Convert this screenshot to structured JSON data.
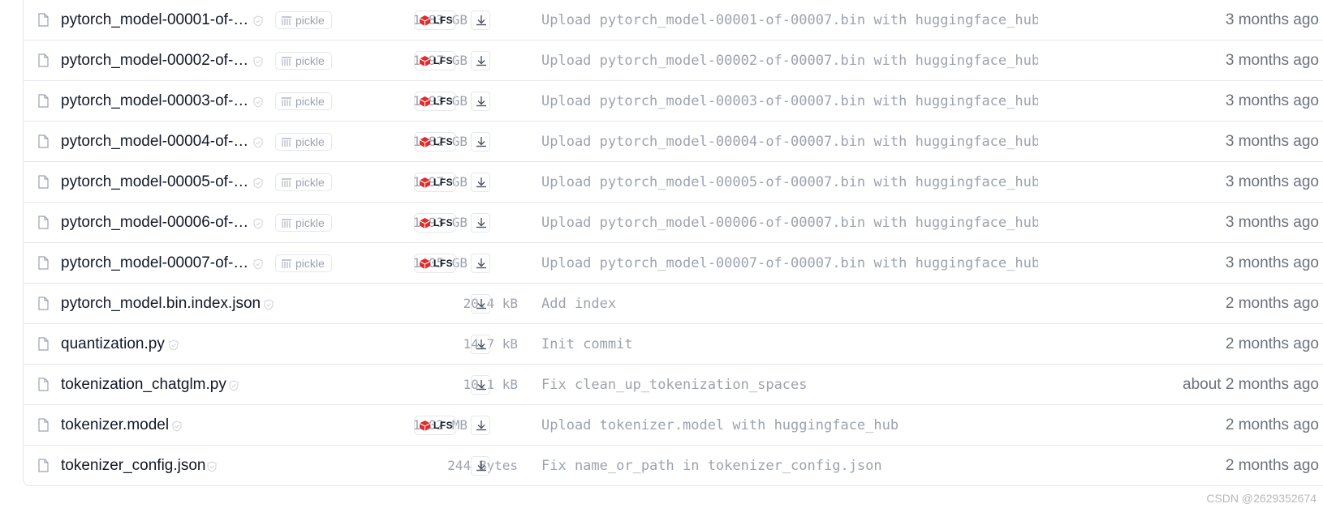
{
  "files": [
    {
      "name": "pytorch_model-00001-of-…",
      "pickle": "pickle",
      "size": "1.83 GB",
      "lfs": "LFS",
      "message": "Upload pytorch_model-00001-of-00007.bin with huggingface_hub",
      "time": "3 months ago"
    },
    {
      "name": "pytorch_model-00002-of-…",
      "pickle": "pickle",
      "size": "1.97 GB",
      "lfs": "LFS",
      "message": "Upload pytorch_model-00002-of-00007.bin with huggingface_hub",
      "time": "3 months ago"
    },
    {
      "name": "pytorch_model-00003-of-…",
      "pickle": "pickle",
      "size": "1.93 GB",
      "lfs": "LFS",
      "message": "Upload pytorch_model-00003-of-00007.bin with huggingface_hub",
      "time": "3 months ago"
    },
    {
      "name": "pytorch_model-00004-of-…",
      "pickle": "pickle",
      "size": "1.82 GB",
      "lfs": "LFS",
      "message": "Upload pytorch_model-00004-of-00007.bin with huggingface_hub",
      "time": "3 months ago"
    },
    {
      "name": "pytorch_model-00005-of-…",
      "pickle": "pickle",
      "size": "1.97 GB",
      "lfs": "LFS",
      "message": "Upload pytorch_model-00005-of-00007.bin with huggingface_hub",
      "time": "3 months ago"
    },
    {
      "name": "pytorch_model-00006-of-…",
      "pickle": "pickle",
      "size": "1.93 GB",
      "lfs": "LFS",
      "message": "Upload pytorch_model-00006-of-00007.bin with huggingface_hub",
      "time": "3 months ago"
    },
    {
      "name": "pytorch_model-00007-of-…",
      "pickle": "pickle",
      "size": "1.05 GB",
      "lfs": "LFS",
      "message": "Upload pytorch_model-00007-of-00007.bin with huggingface_hub",
      "time": "3 months ago"
    },
    {
      "name": "pytorch_model.bin.index.json",
      "size": "20.4 kB",
      "message": "Add index",
      "time": "2 months ago"
    },
    {
      "name": "quantization.py",
      "size": "14.7 kB",
      "message": "Init commit",
      "time": "2 months ago"
    },
    {
      "name": "tokenization_chatglm.py",
      "size": "10.1 kB",
      "message": "Fix clean_up_tokenization_spaces",
      "time": "about 2 months ago"
    },
    {
      "name": "tokenizer.model",
      "size": "1.02 MB",
      "lfs": "LFS",
      "message": "Upload tokenizer.model with huggingface_hub",
      "time": "2 months ago"
    },
    {
      "name": "tokenizer_config.json",
      "size": "244 Bytes",
      "message": "Fix name_or_path in tokenizer_config.json",
      "time": "2 months ago"
    }
  ],
  "icons": {
    "file": "file-icon",
    "shield": "shield-check-icon",
    "pickle": "pickle-jar-icon",
    "lfs": "lfs-cube-icon",
    "download": "download-icon"
  },
  "colors": {
    "lfs_red": "#e02c2c",
    "border": "#e5e7eb",
    "muted": "#9ca3af"
  },
  "watermark": "CSDN @2629352674"
}
